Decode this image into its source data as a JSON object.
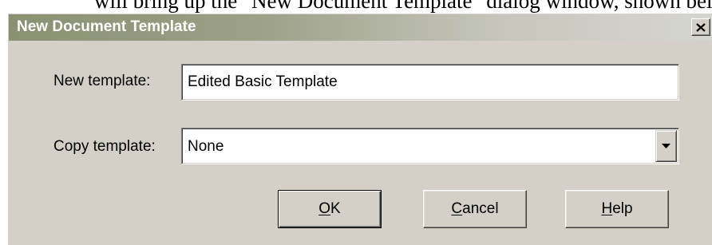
{
  "document": {
    "text": "will bring up the \"New Document Template\" dialog window, shown below."
  },
  "dialog": {
    "title": "New Document Template",
    "close_glyph": "✕",
    "new_template": {
      "label": "New template:",
      "value": "Edited Basic Template"
    },
    "copy_template": {
      "label": "Copy template:",
      "value": "None",
      "dropdown_icon": "chevron-down-icon"
    },
    "buttons": {
      "ok": {
        "mnemonic": "O",
        "rest": "K"
      },
      "cancel": {
        "mnemonic": "C",
        "rest": "ancel"
      },
      "help": {
        "mnemonic": "H",
        "rest": "elp"
      }
    }
  },
  "colors": {
    "dialog_face": "#d4d0c8",
    "titlebar_start": "#8a9172",
    "titlebar_end": "#d6d6d0",
    "title_text": "#ffffff"
  }
}
